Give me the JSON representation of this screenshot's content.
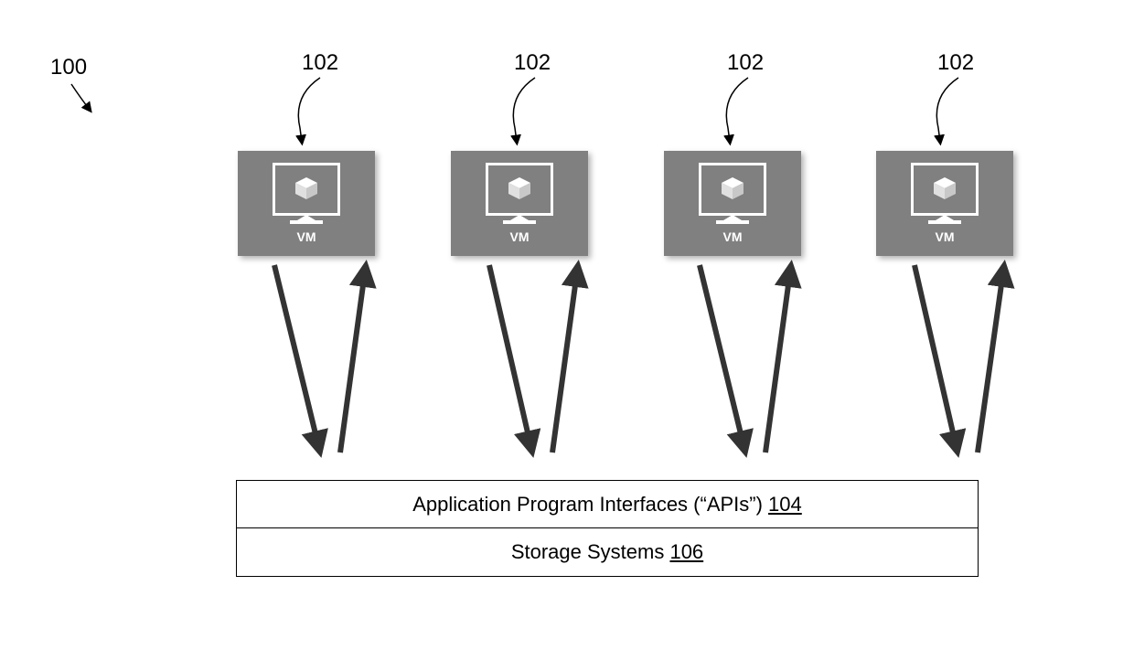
{
  "labels": {
    "figure": "100",
    "vm1": "102",
    "vm2": "102",
    "vm3": "102",
    "vm4": "102",
    "vm_text": "VM",
    "api_text": "Application Program Interfaces (“APIs”) ",
    "api_ref": "104",
    "storage_text": "Storage Systems ",
    "storage_ref": "106"
  }
}
